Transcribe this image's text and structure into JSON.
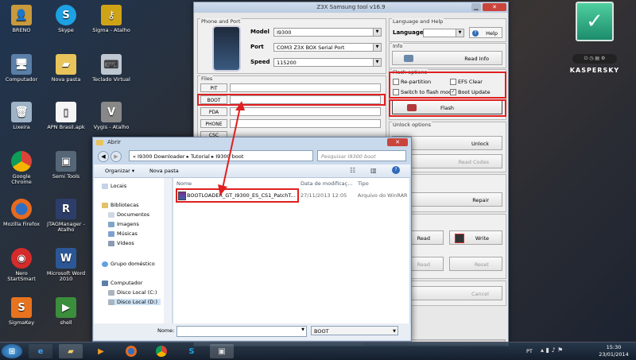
{
  "desktop_icons": [
    {
      "label": "BRENO",
      "icon": "user-folder-icon"
    },
    {
      "label": "Skype",
      "icon": "skype-icon"
    },
    {
      "label": "Sigma - Atalho",
      "icon": "key-icon"
    },
    {
      "label": "Computador",
      "icon": "computer-icon"
    },
    {
      "label": "Nova pasta",
      "icon": "folder-icon"
    },
    {
      "label": "Teclado Virtual",
      "icon": "keyboard-icon"
    },
    {
      "label": "Lixeira",
      "icon": "recycle-bin-icon"
    },
    {
      "label": "APN Brasil.apk",
      "icon": "file-icon"
    },
    {
      "label": "Vygis - Atalho",
      "icon": "vygis-icon"
    },
    {
      "label": "Google Chrome",
      "icon": "chrome-icon"
    },
    {
      "label": "Semi Tools",
      "icon": "semitools-icon"
    },
    {
      "label": "Mozilla Firefox",
      "icon": "firefox-icon"
    },
    {
      "label": "JTAGManager - Atalho",
      "icon": "jtag-icon"
    },
    {
      "label": "Nero StartSmart",
      "icon": "nero-icon"
    },
    {
      "label": "Microsoft Word 2010",
      "icon": "word-icon"
    },
    {
      "label": "SigmaKey",
      "icon": "sigmakey-icon"
    },
    {
      "label": "shell",
      "icon": "shell-icon"
    }
  ],
  "z3x": {
    "title": "Z3X Samsung tool v16.9",
    "phone_port": {
      "caption": "Phone and Port",
      "model_label": "Model",
      "model_value": "I9300",
      "port_label": "Port",
      "port_value": "COM3 Z3X BOX Serial Port",
      "speed_label": "Speed",
      "speed_value": "115200"
    },
    "files": {
      "caption": "Files",
      "buttons": [
        "PIT",
        "BOOT",
        "PDA",
        "PHONE",
        "CSC"
      ]
    },
    "language": {
      "caption": "Language and Help",
      "label": "Language",
      "help_label": "Help"
    },
    "info": {
      "caption": "Info",
      "read_info_label": "Read Info"
    },
    "flash_options": {
      "caption": "Flash options",
      "re_partition": "Re-partition",
      "efs_clear": "EFS Clear",
      "switch_flash": "Switch to flash mode",
      "boot_update": "Boot Update",
      "flash_label": "Flash"
    },
    "unlock": {
      "caption": "Unlock options",
      "unlock_label": "Unlock",
      "read_codes_label": "Read Codes"
    },
    "repair_label": "Repair",
    "read_label": "Read",
    "write_label": "Write",
    "read2_label": "Read",
    "reset_label": "Reset",
    "cancel_label": "Cancel"
  },
  "dialog": {
    "title": "Abrir",
    "breadcrumb": "« I9300 Downloader ▸ Tutorial ▸ I9300 boot",
    "search_placeholder": "Pesquisar I9300 boot",
    "organize_label": "Organizar ▾",
    "new_folder_label": "Nova pasta",
    "nav_items": [
      {
        "label": "Locais",
        "indent": 0
      },
      {
        "label": "Bibliotecas",
        "indent": 0
      },
      {
        "label": "Documentos",
        "indent": 1
      },
      {
        "label": "Imagens",
        "indent": 1
      },
      {
        "label": "Músicas",
        "indent": 1
      },
      {
        "label": "Vídeos",
        "indent": 1
      },
      {
        "label": "Grupo doméstico",
        "indent": 0
      },
      {
        "label": "Computador",
        "indent": 0
      },
      {
        "label": "Disco Local (C:)",
        "indent": 1
      },
      {
        "label": "Disco Local (D:)",
        "indent": 1
      }
    ],
    "columns": [
      "Nome",
      "Data de modificaç...",
      "Tipo"
    ],
    "file": {
      "name": "BOOTLOADER_GT_I9300_ES_CS1_PatchT...",
      "date": "27/11/2013 12:05",
      "type": "Arquivo do WinRAR"
    },
    "name_label": "Nome:",
    "filetype_value": "BOOT"
  },
  "taskbar": {
    "start_icon": "windows-start-icon",
    "apps": [
      "ie-icon",
      "explorer-icon",
      "media-player-icon",
      "firefox-icon",
      "chrome-icon",
      "skype-icon",
      "z3x-icon"
    ],
    "lang": "PT",
    "time": "15:30",
    "date": "23/01/2014"
  },
  "kaspersky": {
    "brand": "KASPERSKY"
  }
}
